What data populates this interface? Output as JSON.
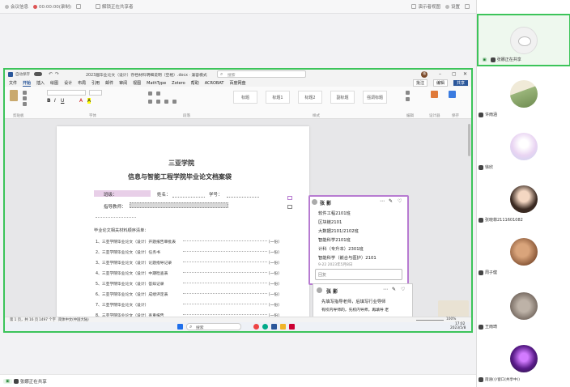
{
  "meeting": {
    "top_left": [
      "会议信息",
      "00:00:00(录制)",
      "解锁正在共享者"
    ],
    "top_right": [
      "演示者视图",
      "设置"
    ],
    "share_banner": "张娜正在共享屏幕",
    "bottom_share": "张娜正在共享"
  },
  "participants": [
    {
      "name": "张娜正在共享",
      "avatar": "cat-face"
    },
    {
      "name": "许雨涵",
      "avatar": "green-landscape"
    },
    {
      "name": "徐欣",
      "avatar": "pastel-gradient"
    },
    {
      "name": "张晓菲2111601082",
      "avatar": "girl-photo"
    },
    {
      "name": "周子健",
      "avatar": "food-photo"
    },
    {
      "name": "王雨琦",
      "avatar": "cat-gray"
    },
    {
      "name": "雨涵(小窗口(共享中))",
      "avatar": "purple-character"
    }
  ],
  "word": {
    "filename": "2023届毕业论文（设计）存档材料明细说明（空格）.docx · 兼容模式",
    "search_placeholder": "搜索",
    "autosave": "自动保存",
    "user": "张",
    "menu": [
      "文件",
      "开始",
      "插入",
      "绘图",
      "设计",
      "布局",
      "引用",
      "邮件",
      "审阅",
      "视图",
      "MathType",
      "Zotero",
      "帮助",
      "ACROBAT",
      "百度网盘"
    ],
    "styles": [
      "标题",
      "标题1",
      "标题2",
      "副标题",
      "强调标题"
    ],
    "groups": [
      "剪贴板",
      "字体",
      "段落",
      "样式",
      "编辑",
      "设计器",
      "保存"
    ],
    "share_btn": "共享",
    "comment_btn": "批注",
    "edit_btn": "编辑"
  },
  "document": {
    "school": "三亚学院",
    "title": "信息与智能工程学院毕业论文档案袋",
    "field_class": "班级：",
    "field_name": "姓名：",
    "field_id": "学号：",
    "field_advisor": "指导教师：",
    "section_title": "毕业论文相关材料顺序清单：",
    "list": [
      {
        "text": "1、三亚学院毕业论文（设计）开题报告审批表",
        "count": "（一份）"
      },
      {
        "text": "2、三亚学院毕业论文（设计）任务书",
        "count": "（一份）"
      },
      {
        "text": "3、三亚学院毕业论文（设计）论题指导记录",
        "count": "（一份）"
      },
      {
        "text": "4、三亚学院毕业论文（设计）中期检查表",
        "count": "（一份）"
      },
      {
        "text": "5、三亚学院毕业论文（设计）答辩记录",
        "count": "（一份）"
      },
      {
        "text": "6、三亚学院毕业论文（设计）成绩评定表",
        "count": "（一份）"
      },
      {
        "text": "7、三亚学院毕业论文（设计）",
        "count": "（一份）"
      },
      {
        "text": "8、三亚学院毕业论文（设计）查重报告",
        "count": "（一份）"
      }
    ]
  },
  "comment1": {
    "author": "张 影",
    "lines": [
      "软件工程2101班",
      "区块链2101",
      "大数据2101/2102班",
      "智能科学2101班",
      "计科（专升本）2301班",
      "智能科学（嵌合与医护）2101"
    ],
    "time": "9-22 2023年5月8日",
    "reply_placeholder": "回复"
  },
  "comment2": {
    "author": "张 影",
    "lines": [
      "先填写指导老师，后填写行业导师",
      "有校内导师的，先校内导师，再填导 老"
    ]
  },
  "statusbar": {
    "page": "第 1 页，共 16 页",
    "words": "1497 个字",
    "lang": "简体中文(中国大陆)",
    "zoom": "100%"
  },
  "taskbar": {
    "search": "搜索",
    "time": "17:02",
    "date": "2023/5/8"
  }
}
